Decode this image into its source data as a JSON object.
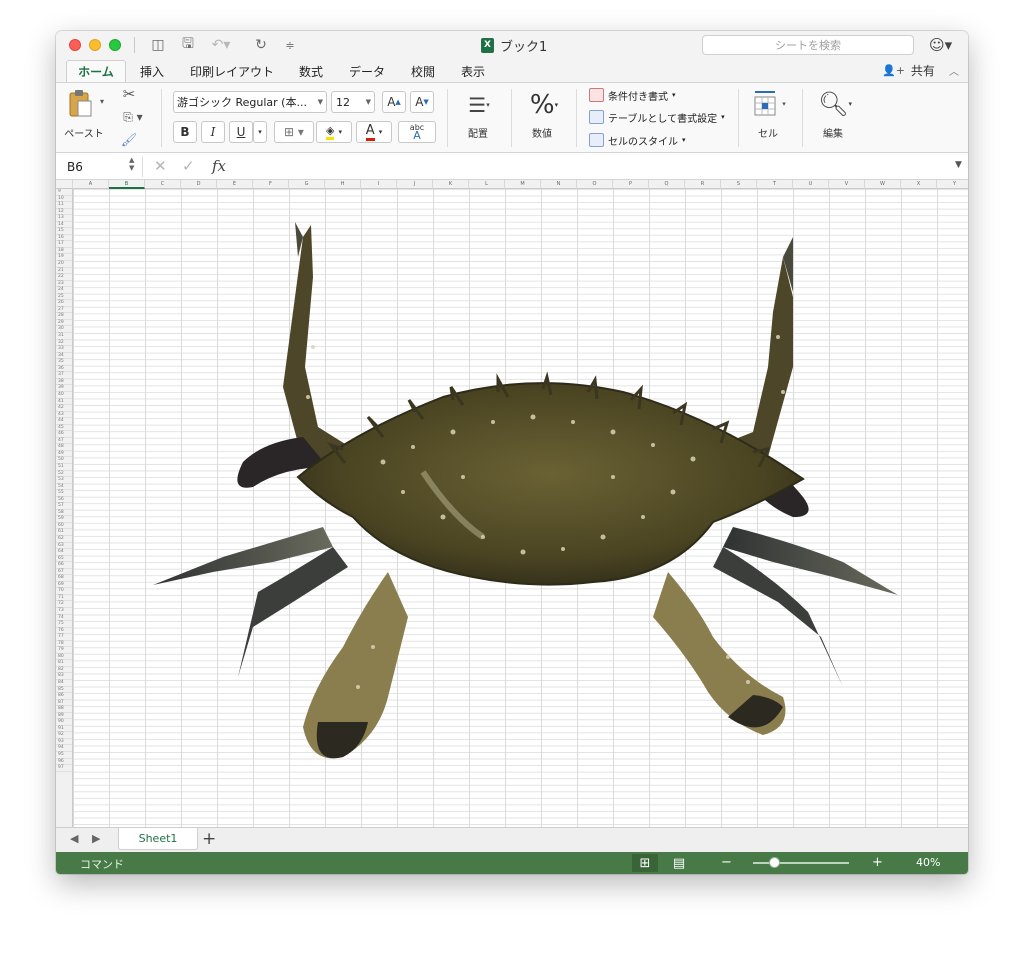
{
  "window": {
    "title": "ブック1",
    "search_placeholder": "シートを検索"
  },
  "tabs": [
    "ホーム",
    "挿入",
    "印刷レイアウト",
    "数式",
    "データ",
    "校閲",
    "表示"
  ],
  "active_tab": "ホーム",
  "share_label": "共有",
  "ribbon": {
    "paste_label": "ペースト",
    "font_name": "游ゴシック Regular (本...",
    "font_size": "12",
    "bold": "B",
    "italic": "I",
    "underline": "U",
    "grow_font": "A",
    "shrink_font": "A",
    "font_color_letter": "A",
    "phonetic_top": "abc",
    "phonetic_bottom": "A",
    "alignment_label": "配置",
    "number_symbol": "%",
    "number_label": "数値",
    "conditional_format": "条件付き書式",
    "format_as_table": "テーブルとして書式設定",
    "cell_styles": "セルのスタイル",
    "cells_label": "セル",
    "editing_label": "編集"
  },
  "formula_bar": {
    "name_box": "B6",
    "fx": "fx",
    "formula": ""
  },
  "columns": [
    "A",
    "B",
    "C",
    "D",
    "E",
    "F",
    "G",
    "H",
    "I",
    "J",
    "K",
    "L",
    "M",
    "N",
    "O",
    "P",
    "Q",
    "R",
    "S",
    "T",
    "U",
    "V",
    "W",
    "X",
    "Y"
  ],
  "row_numbers": [
    "9",
    "10",
    "11",
    "12",
    "13",
    "14",
    "15",
    "16",
    "17",
    "18",
    "19",
    "20",
    "21",
    "22",
    "23",
    "24",
    "25",
    "26",
    "27",
    "28",
    "29",
    "30",
    "31",
    "32",
    "33",
    "34",
    "35",
    "36",
    "37",
    "38",
    "39",
    "40",
    "41",
    "42",
    "43",
    "44",
    "45",
    "46",
    "47",
    "48",
    "49",
    "50",
    "51",
    "52",
    "53",
    "54",
    "55",
    "56",
    "57",
    "58",
    "59",
    "60",
    "61",
    "62",
    "63",
    "64",
    "65",
    "66",
    "67",
    "68",
    "69",
    "70",
    "71",
    "72",
    "73",
    "74",
    "75",
    "76",
    "77",
    "78",
    "79",
    "80",
    "81",
    "82",
    "83",
    "84",
    "85",
    "86",
    "87",
    "88",
    "89",
    "90",
    "91",
    "92",
    "93",
    "94",
    "95",
    "96",
    "97"
  ],
  "sheet_tab": "Sheet1",
  "status": {
    "mode": "コマンド",
    "zoom": "40%",
    "zoom_fraction": 0.4
  },
  "colors": {
    "accent": "#1e7145",
    "status_bar": "#477a47",
    "crab_shell": "#4f4a26",
    "crab_leg": "#3a3d3c"
  },
  "icons": [
    "clipboard-icon",
    "scissors-icon",
    "copy-icon",
    "format-painter-icon",
    "align-icon",
    "percent-icon",
    "cells-icon",
    "magnifier-icon",
    "smiley-icon",
    "share-person-icon"
  ]
}
